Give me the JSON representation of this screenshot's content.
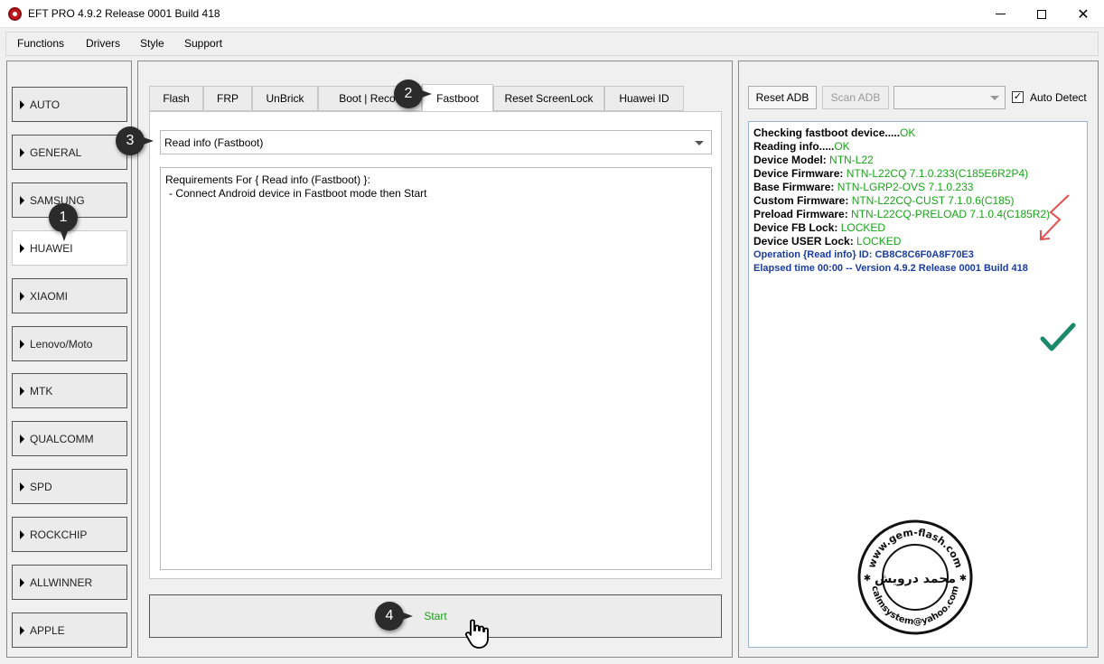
{
  "window": {
    "title": "EFT PRO 4.9.2 Release 0001 Build 418",
    "controls": {
      "close": "✕"
    }
  },
  "menu": [
    "Functions",
    "Drivers",
    "Style",
    "Support"
  ],
  "brands": [
    "AUTO",
    "GENERAL",
    "SAMSUNG",
    "HUAWEI",
    "XIAOMI",
    "Lenovo/Moto",
    "MTK",
    "QUALCOMM",
    "SPD",
    "ROCKCHIP",
    "ALLWINNER",
    "APPLE"
  ],
  "active_brand": "HUAWEI",
  "tabs": [
    "Flash",
    "FRP",
    "UnBrick",
    "Boot | Recov",
    "Fastboot",
    "Reset ScreenLock",
    "Huawei ID"
  ],
  "active_tab": "Fastboot",
  "operation": {
    "selected": "Read info (Fastboot)"
  },
  "requirements": {
    "line1": "Requirements For { Read info (Fastboot) }:",
    "line2": "- Connect Android device in Fastboot mode then Start"
  },
  "start_label": "Start",
  "callouts": [
    "1",
    "2",
    "3",
    "4"
  ],
  "right": {
    "reset_adb": "Reset ADB",
    "scan_adb": "Scan ADB",
    "auto_detect_label": "Auto Detect",
    "auto_detect_checked": true,
    "auto_detect_mark": "✓"
  },
  "log": {
    "checking": {
      "key": "Checking fastboot device.....",
      "val": "OK"
    },
    "reading": {
      "key": "Reading info.....",
      "val": "OK"
    },
    "model": {
      "key": "Device Model: ",
      "val": "NTN-L22"
    },
    "firmware": {
      "key": "Device Firmware: ",
      "val": "NTN-L22CQ 7.1.0.233(C185E6R2P4)"
    },
    "base": {
      "key": "Base Firmware: ",
      "val": "NTN-LGRP2-OVS 7.1.0.233"
    },
    "custom": {
      "key": "Custom Firmware: ",
      "val": "NTN-L22CQ-CUST 7.1.0.6(C185)"
    },
    "preload": {
      "key": "Preload Firmware: ",
      "val": "NTN-L22CQ-PRELOAD 7.1.0.4(C185R2)"
    },
    "fb_lock": {
      "key": "Device FB Lock: ",
      "val": "LOCKED"
    },
    "user_lock": {
      "key": "Device USER Lock: ",
      "val": "LOCKED"
    },
    "operation_id": "Operation {Read info} ID: CB8C8C6F0A8F70E3",
    "elapsed": "Elapsed time 00:00 -- Version 4.9.2 Release 0001 Build 418"
  },
  "stamp": {
    "top_text": "www.gem-flash.com",
    "bottom_text": "calmsystem@yahoo.com",
    "script_text": "محمد درويش"
  },
  "colors": {
    "log_ok": "#18a418",
    "log_info": "#1a3ca0",
    "start_text": "#1a9e1a",
    "arrow": "#e05050",
    "check": "#1a8a6a"
  }
}
